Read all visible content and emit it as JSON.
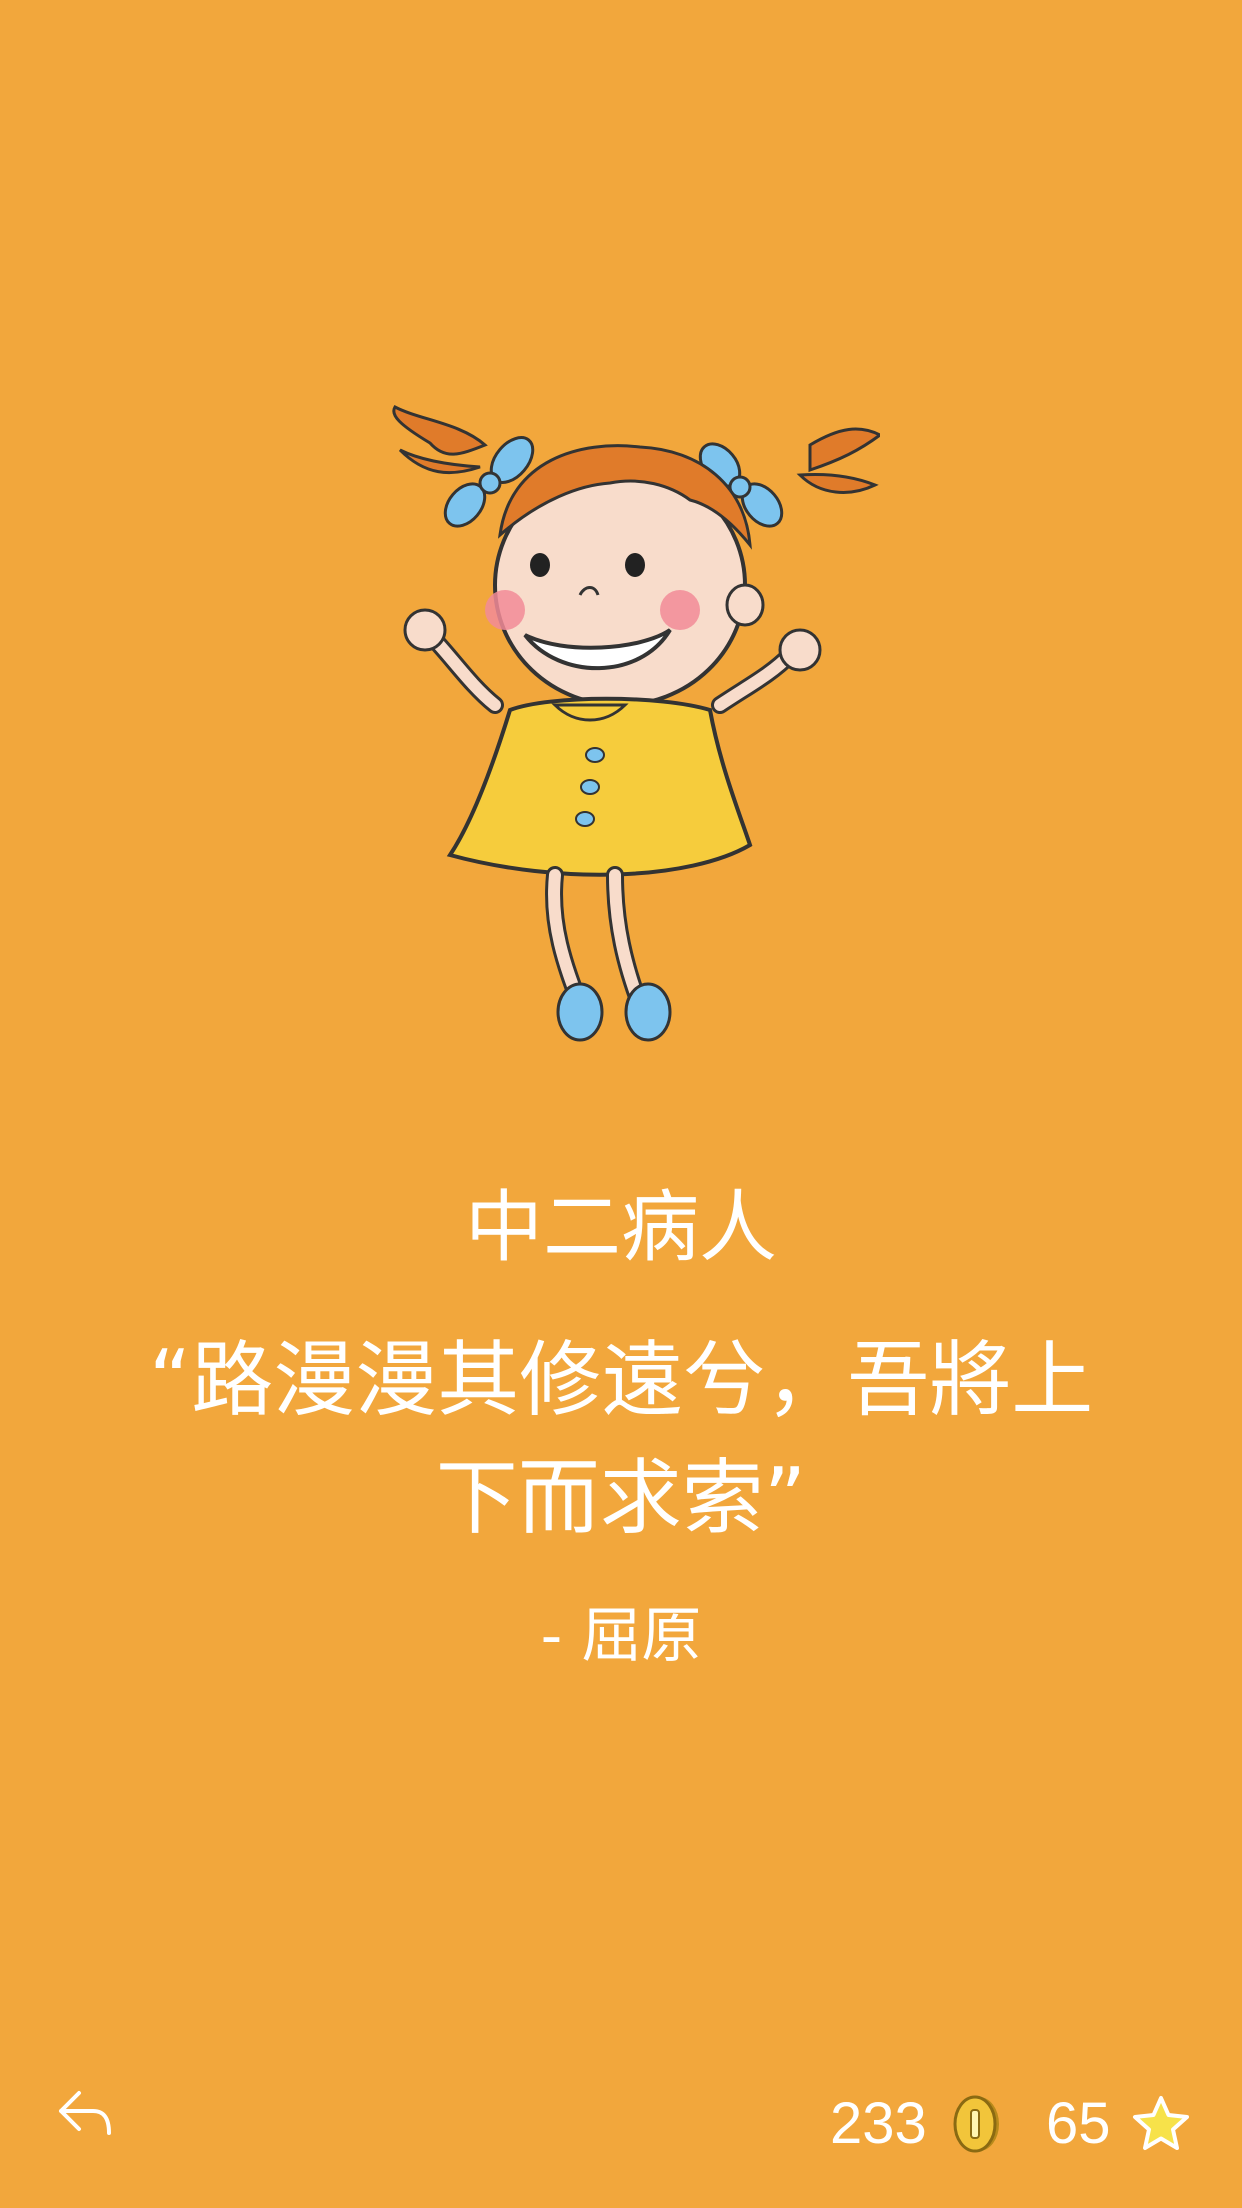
{
  "content": {
    "title": "中二病人",
    "quote": "“路漫漫其修遠兮，吾將上下而求索”",
    "author": "- 屈原"
  },
  "footer": {
    "coins": "233",
    "stars": "65"
  },
  "icons": {
    "back": "reply-arrow-icon",
    "coin": "coin-icon",
    "star": "star-icon"
  },
  "colors": {
    "background": "#F2A73C",
    "text": "#FFFFFF"
  }
}
